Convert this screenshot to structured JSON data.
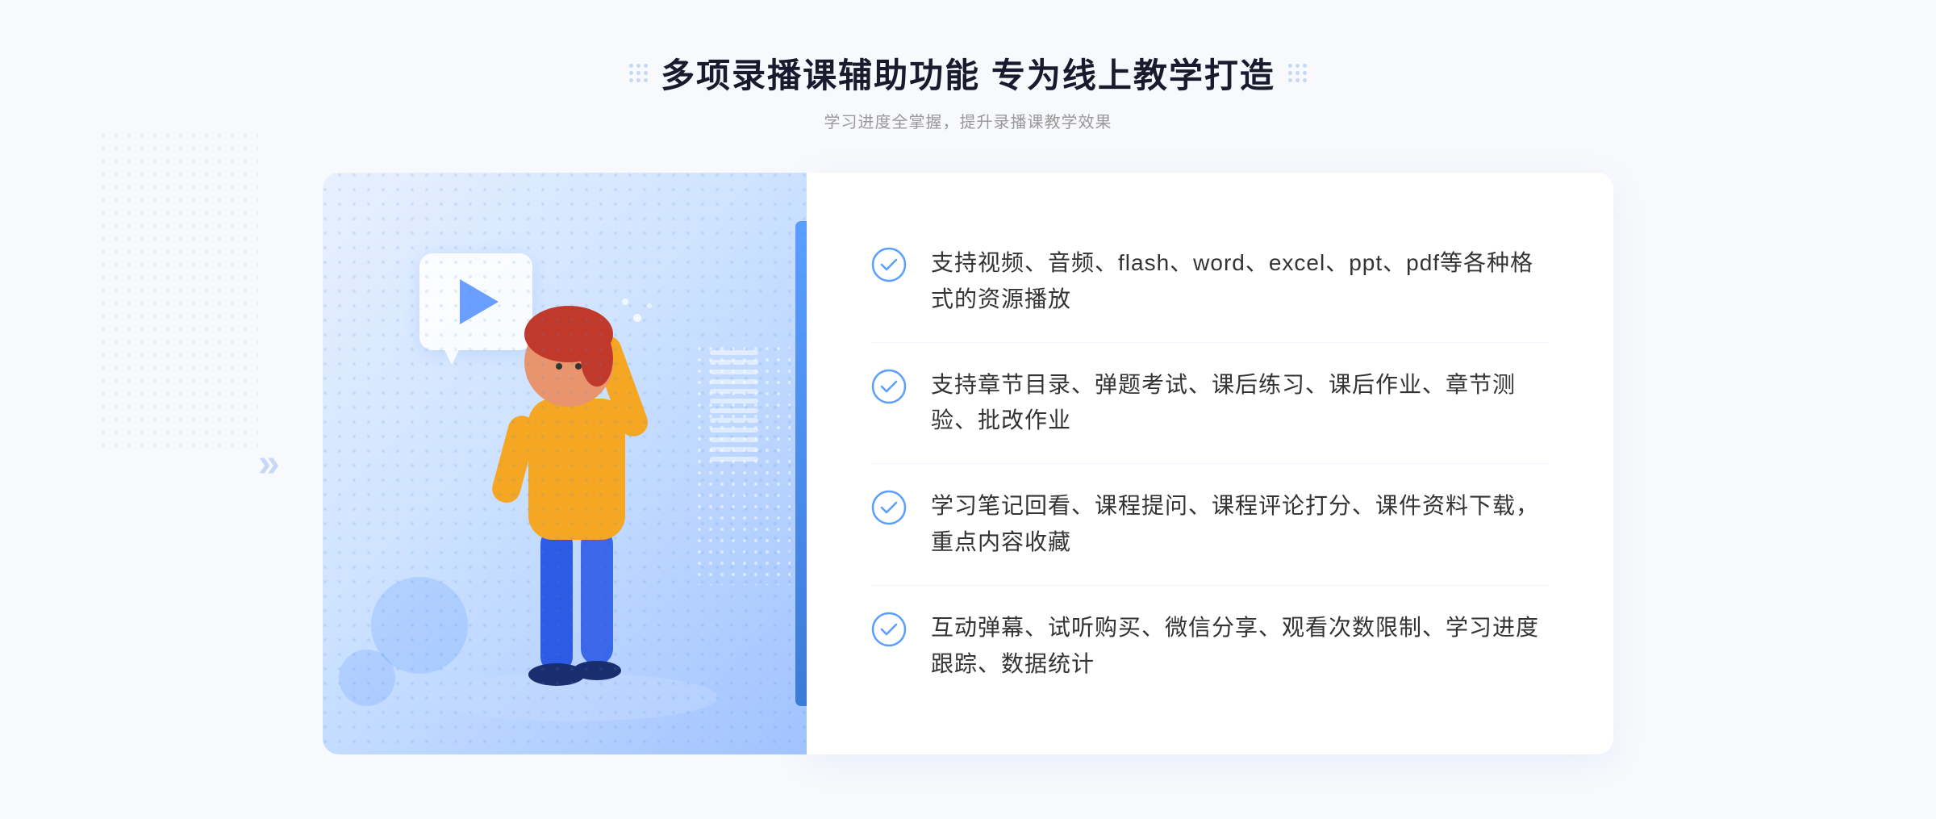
{
  "header": {
    "title": "多项录播课辅助功能 专为线上教学打造",
    "subtitle": "学习进度全掌握，提升录播课教学效果"
  },
  "features": [
    {
      "id": 1,
      "text": "支持视频、音频、flash、word、excel、ppt、pdf等各种格式的资源播放"
    },
    {
      "id": 2,
      "text": "支持章节目录、弹题考试、课后练习、课后作业、章节测验、批改作业"
    },
    {
      "id": 3,
      "text": "学习笔记回看、课程提问、课程评论打分、课件资料下载，重点内容收藏"
    },
    {
      "id": 4,
      "text": "互动弹幕、试听购买、微信分享、观看次数限制、学习进度跟踪、数据统计"
    }
  ],
  "colors": {
    "accent_blue": "#4a90e2",
    "light_blue": "#e8f2ff",
    "check_color": "#5a9eff",
    "title_color": "#1a1a2e",
    "text_color": "#333333",
    "subtitle_color": "#999999"
  }
}
